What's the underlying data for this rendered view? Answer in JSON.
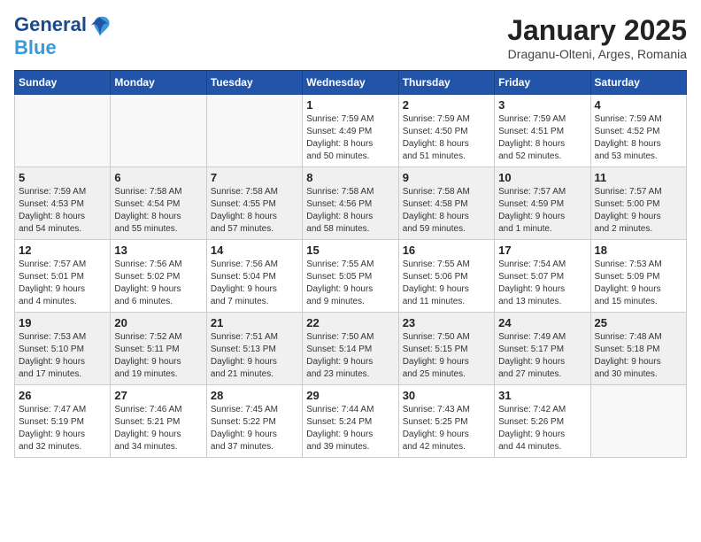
{
  "logo": {
    "line1": "General",
    "line2": "Blue"
  },
  "title": "January 2025",
  "location": "Draganu-Olteni, Arges, Romania",
  "weekdays": [
    "Sunday",
    "Monday",
    "Tuesday",
    "Wednesday",
    "Thursday",
    "Friday",
    "Saturday"
  ],
  "weeks": [
    [
      {
        "day": "",
        "info": ""
      },
      {
        "day": "",
        "info": ""
      },
      {
        "day": "",
        "info": ""
      },
      {
        "day": "1",
        "info": "Sunrise: 7:59 AM\nSunset: 4:49 PM\nDaylight: 8 hours\nand 50 minutes."
      },
      {
        "day": "2",
        "info": "Sunrise: 7:59 AM\nSunset: 4:50 PM\nDaylight: 8 hours\nand 51 minutes."
      },
      {
        "day": "3",
        "info": "Sunrise: 7:59 AM\nSunset: 4:51 PM\nDaylight: 8 hours\nand 52 minutes."
      },
      {
        "day": "4",
        "info": "Sunrise: 7:59 AM\nSunset: 4:52 PM\nDaylight: 8 hours\nand 53 minutes."
      }
    ],
    [
      {
        "day": "5",
        "info": "Sunrise: 7:59 AM\nSunset: 4:53 PM\nDaylight: 8 hours\nand 54 minutes."
      },
      {
        "day": "6",
        "info": "Sunrise: 7:58 AM\nSunset: 4:54 PM\nDaylight: 8 hours\nand 55 minutes."
      },
      {
        "day": "7",
        "info": "Sunrise: 7:58 AM\nSunset: 4:55 PM\nDaylight: 8 hours\nand 57 minutes."
      },
      {
        "day": "8",
        "info": "Sunrise: 7:58 AM\nSunset: 4:56 PM\nDaylight: 8 hours\nand 58 minutes."
      },
      {
        "day": "9",
        "info": "Sunrise: 7:58 AM\nSunset: 4:58 PM\nDaylight: 8 hours\nand 59 minutes."
      },
      {
        "day": "10",
        "info": "Sunrise: 7:57 AM\nSunset: 4:59 PM\nDaylight: 9 hours\nand 1 minute."
      },
      {
        "day": "11",
        "info": "Sunrise: 7:57 AM\nSunset: 5:00 PM\nDaylight: 9 hours\nand 2 minutes."
      }
    ],
    [
      {
        "day": "12",
        "info": "Sunrise: 7:57 AM\nSunset: 5:01 PM\nDaylight: 9 hours\nand 4 minutes."
      },
      {
        "day": "13",
        "info": "Sunrise: 7:56 AM\nSunset: 5:02 PM\nDaylight: 9 hours\nand 6 minutes."
      },
      {
        "day": "14",
        "info": "Sunrise: 7:56 AM\nSunset: 5:04 PM\nDaylight: 9 hours\nand 7 minutes."
      },
      {
        "day": "15",
        "info": "Sunrise: 7:55 AM\nSunset: 5:05 PM\nDaylight: 9 hours\nand 9 minutes."
      },
      {
        "day": "16",
        "info": "Sunrise: 7:55 AM\nSunset: 5:06 PM\nDaylight: 9 hours\nand 11 minutes."
      },
      {
        "day": "17",
        "info": "Sunrise: 7:54 AM\nSunset: 5:07 PM\nDaylight: 9 hours\nand 13 minutes."
      },
      {
        "day": "18",
        "info": "Sunrise: 7:53 AM\nSunset: 5:09 PM\nDaylight: 9 hours\nand 15 minutes."
      }
    ],
    [
      {
        "day": "19",
        "info": "Sunrise: 7:53 AM\nSunset: 5:10 PM\nDaylight: 9 hours\nand 17 minutes."
      },
      {
        "day": "20",
        "info": "Sunrise: 7:52 AM\nSunset: 5:11 PM\nDaylight: 9 hours\nand 19 minutes."
      },
      {
        "day": "21",
        "info": "Sunrise: 7:51 AM\nSunset: 5:13 PM\nDaylight: 9 hours\nand 21 minutes."
      },
      {
        "day": "22",
        "info": "Sunrise: 7:50 AM\nSunset: 5:14 PM\nDaylight: 9 hours\nand 23 minutes."
      },
      {
        "day": "23",
        "info": "Sunrise: 7:50 AM\nSunset: 5:15 PM\nDaylight: 9 hours\nand 25 minutes."
      },
      {
        "day": "24",
        "info": "Sunrise: 7:49 AM\nSunset: 5:17 PM\nDaylight: 9 hours\nand 27 minutes."
      },
      {
        "day": "25",
        "info": "Sunrise: 7:48 AM\nSunset: 5:18 PM\nDaylight: 9 hours\nand 30 minutes."
      }
    ],
    [
      {
        "day": "26",
        "info": "Sunrise: 7:47 AM\nSunset: 5:19 PM\nDaylight: 9 hours\nand 32 minutes."
      },
      {
        "day": "27",
        "info": "Sunrise: 7:46 AM\nSunset: 5:21 PM\nDaylight: 9 hours\nand 34 minutes."
      },
      {
        "day": "28",
        "info": "Sunrise: 7:45 AM\nSunset: 5:22 PM\nDaylight: 9 hours\nand 37 minutes."
      },
      {
        "day": "29",
        "info": "Sunrise: 7:44 AM\nSunset: 5:24 PM\nDaylight: 9 hours\nand 39 minutes."
      },
      {
        "day": "30",
        "info": "Sunrise: 7:43 AM\nSunset: 5:25 PM\nDaylight: 9 hours\nand 42 minutes."
      },
      {
        "day": "31",
        "info": "Sunrise: 7:42 AM\nSunset: 5:26 PM\nDaylight: 9 hours\nand 44 minutes."
      },
      {
        "day": "",
        "info": ""
      }
    ]
  ],
  "shading": [
    false,
    true,
    false,
    true,
    false
  ]
}
